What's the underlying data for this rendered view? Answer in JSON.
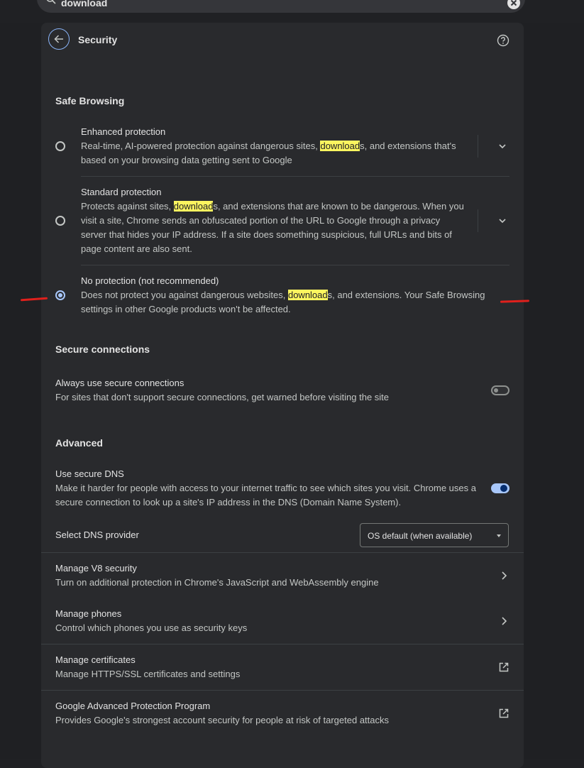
{
  "search": {
    "query": "download"
  },
  "header": {
    "title": "Security"
  },
  "safe_browsing": {
    "title": "Safe Browsing",
    "options": [
      {
        "label": "Enhanced protection",
        "desc_before": "Real-time, AI-powered protection against dangerous sites, ",
        "highlight": "download",
        "desc_after": "s, and extensions that's based on your browsing data getting sent to Google",
        "selected": false
      },
      {
        "label": "Standard protection",
        "desc_before": "Protects against sites, ",
        "highlight": "download",
        "desc_after": "s, and extensions that are known to be dangerous. When you visit a site, Chrome sends an obfuscated portion of the URL to Google through a privacy server that hides your IP address. If a site does something suspicious, full URLs and bits of page content are also sent.",
        "selected": false
      },
      {
        "label": "No protection (not recommended)",
        "desc_before": "Does not protect you against dangerous websites, ",
        "highlight": "download",
        "desc_after": "s, and extensions. Your Safe Browsing settings in other Google products won't be affected.",
        "selected": true
      }
    ]
  },
  "secure_connections": {
    "title": "Secure connections",
    "always_https": {
      "label": "Always use secure connections",
      "desc": "For sites that don't support secure connections, get warned before visiting the site",
      "enabled": false
    }
  },
  "advanced": {
    "title": "Advanced",
    "secure_dns": {
      "label": "Use secure DNS",
      "desc": "Make it harder for people with access to your internet traffic to see which sites you visit. Chrome uses a secure connection to look up a site's IP address in the DNS (Domain Name System).",
      "enabled": true
    },
    "dns_provider": {
      "label": "Select DNS provider",
      "selected": "OS default (when available)"
    },
    "rows": [
      {
        "label": "Manage V8 security",
        "desc": "Turn on additional protection in Chrome's JavaScript and WebAssembly engine",
        "icon": "chevron-right-icon"
      },
      {
        "label": "Manage phones",
        "desc": "Control which phones you use as security keys",
        "icon": "chevron-right-icon"
      },
      {
        "label": "Manage certificates",
        "desc": "Manage HTTPS/SSL certificates and settings",
        "icon": "open-in-new-icon"
      },
      {
        "label": "Google Advanced Protection Program",
        "desc": "Provides Google's strongest account security for people at risk of targeted attacks",
        "icon": "open-in-new-icon"
      }
    ]
  },
  "colors": {
    "background": "#202124",
    "panel": "#292a2d",
    "accent": "#a8c7fa",
    "highlight": "#fcf55f",
    "annotation": "#e0201c"
  }
}
